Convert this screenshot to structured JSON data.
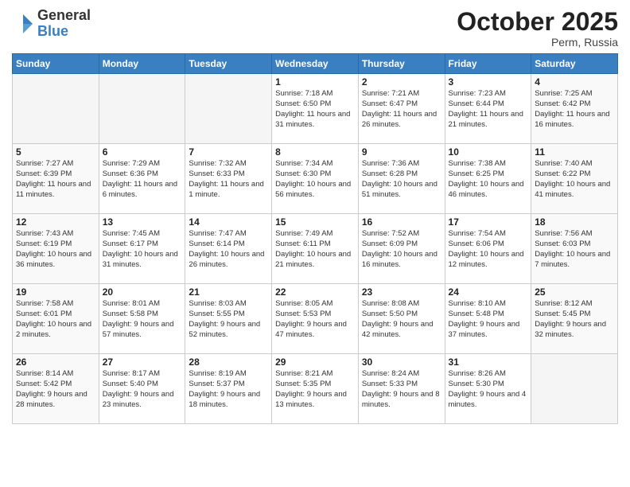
{
  "header": {
    "logo_general": "General",
    "logo_blue": "Blue",
    "month": "October 2025",
    "location": "Perm, Russia"
  },
  "days_of_week": [
    "Sunday",
    "Monday",
    "Tuesday",
    "Wednesday",
    "Thursday",
    "Friday",
    "Saturday"
  ],
  "weeks": [
    [
      {
        "day": "",
        "info": ""
      },
      {
        "day": "",
        "info": ""
      },
      {
        "day": "",
        "info": ""
      },
      {
        "day": "1",
        "info": "Sunrise: 7:18 AM\nSunset: 6:50 PM\nDaylight: 11 hours\nand 31 minutes."
      },
      {
        "day": "2",
        "info": "Sunrise: 7:21 AM\nSunset: 6:47 PM\nDaylight: 11 hours\nand 26 minutes."
      },
      {
        "day": "3",
        "info": "Sunrise: 7:23 AM\nSunset: 6:44 PM\nDaylight: 11 hours\nand 21 minutes."
      },
      {
        "day": "4",
        "info": "Sunrise: 7:25 AM\nSunset: 6:42 PM\nDaylight: 11 hours\nand 16 minutes."
      }
    ],
    [
      {
        "day": "5",
        "info": "Sunrise: 7:27 AM\nSunset: 6:39 PM\nDaylight: 11 hours\nand 11 minutes."
      },
      {
        "day": "6",
        "info": "Sunrise: 7:29 AM\nSunset: 6:36 PM\nDaylight: 11 hours\nand 6 minutes."
      },
      {
        "day": "7",
        "info": "Sunrise: 7:32 AM\nSunset: 6:33 PM\nDaylight: 11 hours\nand 1 minute."
      },
      {
        "day": "8",
        "info": "Sunrise: 7:34 AM\nSunset: 6:30 PM\nDaylight: 10 hours\nand 56 minutes."
      },
      {
        "day": "9",
        "info": "Sunrise: 7:36 AM\nSunset: 6:28 PM\nDaylight: 10 hours\nand 51 minutes."
      },
      {
        "day": "10",
        "info": "Sunrise: 7:38 AM\nSunset: 6:25 PM\nDaylight: 10 hours\nand 46 minutes."
      },
      {
        "day": "11",
        "info": "Sunrise: 7:40 AM\nSunset: 6:22 PM\nDaylight: 10 hours\nand 41 minutes."
      }
    ],
    [
      {
        "day": "12",
        "info": "Sunrise: 7:43 AM\nSunset: 6:19 PM\nDaylight: 10 hours\nand 36 minutes."
      },
      {
        "day": "13",
        "info": "Sunrise: 7:45 AM\nSunset: 6:17 PM\nDaylight: 10 hours\nand 31 minutes."
      },
      {
        "day": "14",
        "info": "Sunrise: 7:47 AM\nSunset: 6:14 PM\nDaylight: 10 hours\nand 26 minutes."
      },
      {
        "day": "15",
        "info": "Sunrise: 7:49 AM\nSunset: 6:11 PM\nDaylight: 10 hours\nand 21 minutes."
      },
      {
        "day": "16",
        "info": "Sunrise: 7:52 AM\nSunset: 6:09 PM\nDaylight: 10 hours\nand 16 minutes."
      },
      {
        "day": "17",
        "info": "Sunrise: 7:54 AM\nSunset: 6:06 PM\nDaylight: 10 hours\nand 12 minutes."
      },
      {
        "day": "18",
        "info": "Sunrise: 7:56 AM\nSunset: 6:03 PM\nDaylight: 10 hours\nand 7 minutes."
      }
    ],
    [
      {
        "day": "19",
        "info": "Sunrise: 7:58 AM\nSunset: 6:01 PM\nDaylight: 10 hours\nand 2 minutes."
      },
      {
        "day": "20",
        "info": "Sunrise: 8:01 AM\nSunset: 5:58 PM\nDaylight: 9 hours\nand 57 minutes."
      },
      {
        "day": "21",
        "info": "Sunrise: 8:03 AM\nSunset: 5:55 PM\nDaylight: 9 hours\nand 52 minutes."
      },
      {
        "day": "22",
        "info": "Sunrise: 8:05 AM\nSunset: 5:53 PM\nDaylight: 9 hours\nand 47 minutes."
      },
      {
        "day": "23",
        "info": "Sunrise: 8:08 AM\nSunset: 5:50 PM\nDaylight: 9 hours\nand 42 minutes."
      },
      {
        "day": "24",
        "info": "Sunrise: 8:10 AM\nSunset: 5:48 PM\nDaylight: 9 hours\nand 37 minutes."
      },
      {
        "day": "25",
        "info": "Sunrise: 8:12 AM\nSunset: 5:45 PM\nDaylight: 9 hours\nand 32 minutes."
      }
    ],
    [
      {
        "day": "26",
        "info": "Sunrise: 8:14 AM\nSunset: 5:42 PM\nDaylight: 9 hours\nand 28 minutes."
      },
      {
        "day": "27",
        "info": "Sunrise: 8:17 AM\nSunset: 5:40 PM\nDaylight: 9 hours\nand 23 minutes."
      },
      {
        "day": "28",
        "info": "Sunrise: 8:19 AM\nSunset: 5:37 PM\nDaylight: 9 hours\nand 18 minutes."
      },
      {
        "day": "29",
        "info": "Sunrise: 8:21 AM\nSunset: 5:35 PM\nDaylight: 9 hours\nand 13 minutes."
      },
      {
        "day": "30",
        "info": "Sunrise: 8:24 AM\nSunset: 5:33 PM\nDaylight: 9 hours\nand 8 minutes."
      },
      {
        "day": "31",
        "info": "Sunrise: 8:26 AM\nSunset: 5:30 PM\nDaylight: 9 hours\nand 4 minutes."
      },
      {
        "day": "",
        "info": ""
      }
    ]
  ]
}
